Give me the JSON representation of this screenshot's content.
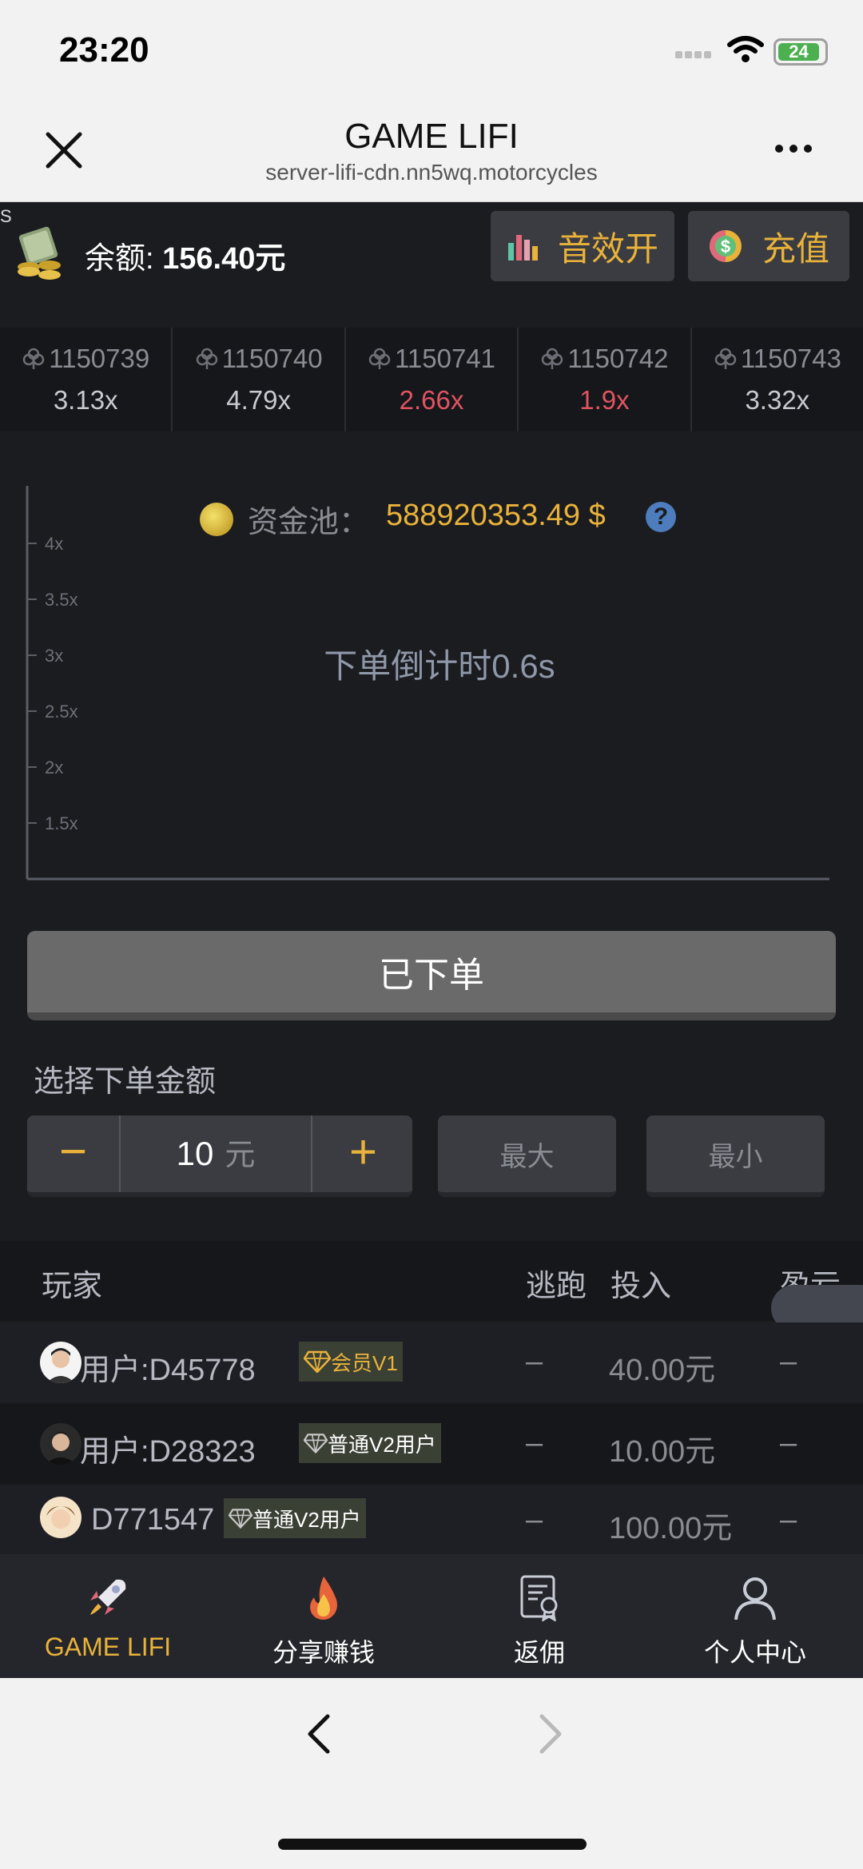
{
  "status_bar": {
    "time": "23:20",
    "battery": "24"
  },
  "browser": {
    "title": "GAME LIFI",
    "url": "server-lifi-cdn.nn5wq.motorcycles"
  },
  "app": {
    "corner_mark": "S",
    "balance_label": "余额: ",
    "balance_value": "156.40元",
    "sound_label": "音效开",
    "recharge_label": "充值",
    "history": [
      {
        "round": "1150739",
        "mult": "3.13x",
        "color": "#c7cad1"
      },
      {
        "round": "1150740",
        "mult": "4.79x",
        "color": "#c7cad1"
      },
      {
        "round": "1150741",
        "mult": "2.66x",
        "color": "#e05462"
      },
      {
        "round": "1150742",
        "mult": "1.9x",
        "color": "#e05462"
      },
      {
        "round": "1150743",
        "mult": "3.32x",
        "color": "#c7cad1"
      }
    ],
    "pool_label": "资金池：",
    "pool_value": "588920353.49 $",
    "help_icon": "?",
    "countdown": "下单倒计时0.6s",
    "chart_y_ticks": [
      "4x",
      "3.5x",
      "3x",
      "2.5x",
      "2x",
      "1.5x"
    ],
    "placed_button": "已下单",
    "amount_title": "选择下单金额",
    "amount_value": "10",
    "amount_unit": "元",
    "minus_label": "−",
    "plus_label": "+",
    "max_label": "最大",
    "min_label": "最小",
    "table_headers": {
      "player": "玩家",
      "escape": "逃跑",
      "bet": "投入",
      "profit": "盈亏"
    },
    "rows": [
      {
        "name": "用户:D45778",
        "badge": "会员V1",
        "escape": "–",
        "bet": "40.00元",
        "profit": "–"
      },
      {
        "name": "用户:D28323",
        "badge": "普通V2用户",
        "escape": "–",
        "bet": "10.00元",
        "profit": "–"
      },
      {
        "name": "D771547",
        "badge": "普通V2用户",
        "escape": "–",
        "bet": "100.00元",
        "profit": "–"
      }
    ],
    "tabs": [
      {
        "label": "GAME LIFI",
        "icon": "rocket-icon",
        "active": true
      },
      {
        "label": "分享赚钱",
        "icon": "fire-icon",
        "active": false
      },
      {
        "label": "返佣",
        "icon": "certificate-icon",
        "active": false
      },
      {
        "label": "个人中心",
        "icon": "user-icon",
        "active": false
      }
    ],
    "accent_color": "#e9b23a"
  }
}
